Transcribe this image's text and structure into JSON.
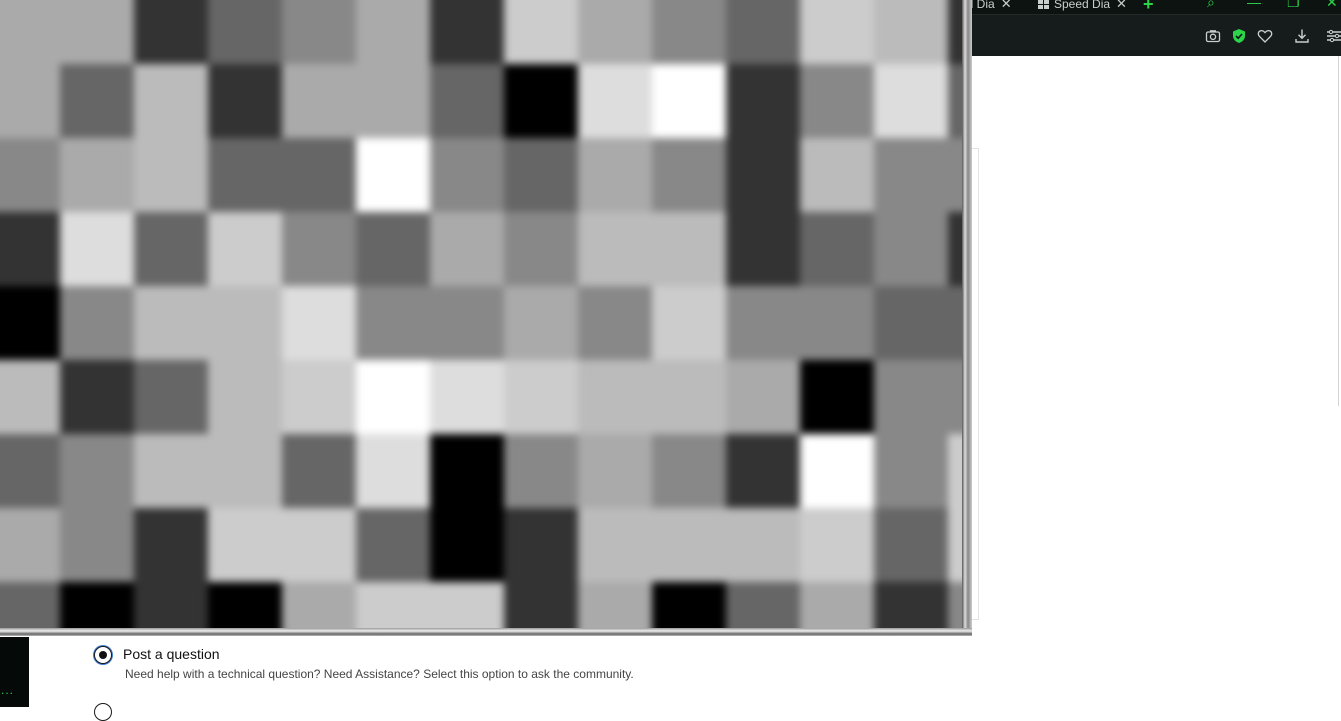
{
  "browser": {
    "tabs": [
      {
        "label": "ed Dia",
        "icon": "speed-dial-icon"
      },
      {
        "label": "Speed Dia",
        "icon": "speed-dial-icon"
      }
    ],
    "new_tab_icon": "plus-icon",
    "window_controls": [
      "minimize-icon",
      "restore-icon",
      "close-icon"
    ],
    "toolbar_icons": [
      "camera-icon",
      "shield-check-icon",
      "heart-icon",
      "download-icon",
      "menu-icon"
    ],
    "accent_color": "#2cd44a"
  },
  "form": {
    "options": [
      {
        "title": "Post a question",
        "description": "Need help with a technical question? Need Assistance? Select this option to ask the community.",
        "selected": true
      },
      {
        "title": "",
        "description": "",
        "selected": false
      }
    ]
  },
  "sidebar": {
    "dots": "..."
  }
}
